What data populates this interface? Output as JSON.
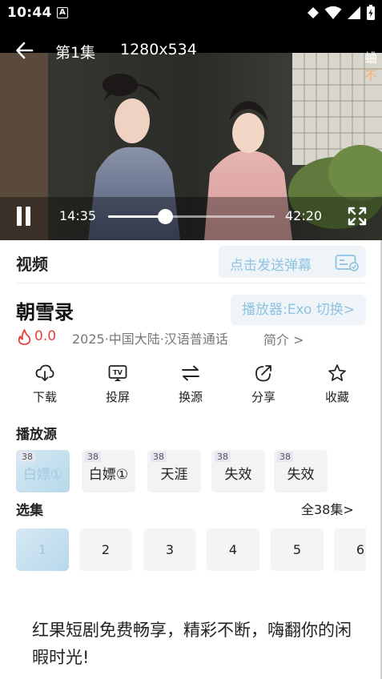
{
  "status_bar": {
    "time": "10:44",
    "notification_badge": "A"
  },
  "player": {
    "episode_title": "第1集",
    "resolution": "1280x534",
    "floating_danmu": [
      "蛐",
      "不"
    ],
    "current_time": "14:35",
    "duration": "42:20",
    "progress_fraction": 0.34
  },
  "panel": {
    "section_title": "视频",
    "danmu_placeholder": "点击发送弹幕",
    "show_title": "朝雪录",
    "player_switch": "播放器:Exo 切换>",
    "rating": "0.0",
    "meta": "2025·中国大陆·汉语普通话",
    "intro_link": "简介 >",
    "actions": [
      {
        "label": "下载",
        "icon": "download-icon"
      },
      {
        "label": "投屏",
        "icon": "tv-cast-icon"
      },
      {
        "label": "换源",
        "icon": "switch-source-icon"
      },
      {
        "label": "分享",
        "icon": "share-icon"
      },
      {
        "label": "收藏",
        "icon": "star-icon"
      }
    ],
    "source_title": "播放源",
    "sources": [
      {
        "count": "38",
        "name": "白嫖①"
      },
      {
        "count": "38",
        "name": "白嫖①"
      },
      {
        "count": "38",
        "name": "天涯"
      },
      {
        "count": "38",
        "name": "失效"
      },
      {
        "count": "38",
        "name": "失效"
      }
    ],
    "episode_section_title": "选集",
    "episode_all": "全38集>",
    "episodes": [
      "1",
      "2",
      "3",
      "4",
      "5",
      "6"
    ],
    "promo_text": "红果短剧免费畅享，精彩不断，嗨翻你的闲暇时光!"
  },
  "colors": {
    "accent_light": "#8fc3e0",
    "rating_red": "#e8413b",
    "active_bg": "#c6e0ef"
  }
}
